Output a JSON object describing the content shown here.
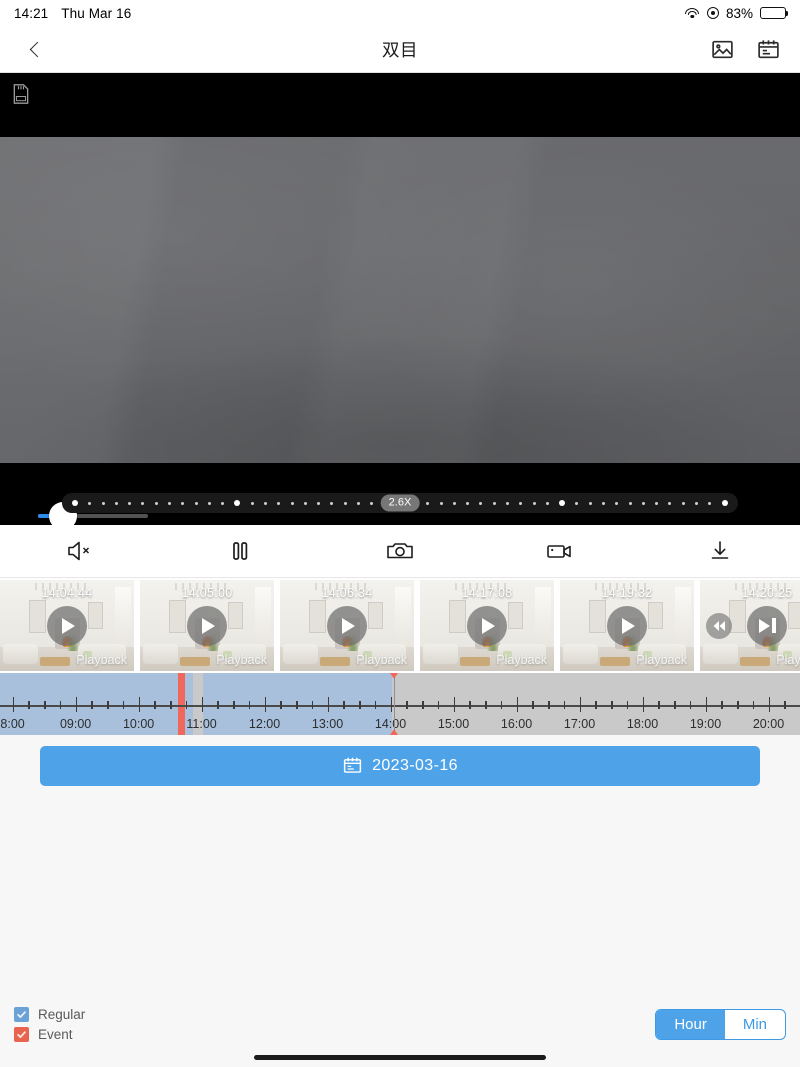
{
  "status_bar": {
    "time": "14:21",
    "date": "Thu Mar 16",
    "battery_percent": "83%",
    "wifi_icon": "wifi-icon",
    "location_icon": "location-icon",
    "battery_icon": "battery-icon"
  },
  "nav": {
    "back_icon": "back-chevron-icon",
    "title": "双目",
    "gallery_icon": "image-gallery-icon",
    "calendar_icon": "calendar-icon"
  },
  "stage": {
    "sd_card_icon": "sd-card-icon",
    "zoom_slider": {
      "value": 23,
      "accent": "#2d8cf0"
    },
    "speed": {
      "label": "2.6X",
      "dot_count": 49,
      "major_dots": [
        0,
        12,
        24,
        36,
        48
      ]
    }
  },
  "toolbar": [
    {
      "name": "mute-button",
      "icon": "speaker-mute-icon"
    },
    {
      "name": "pause-button",
      "icon": "pause-icon"
    },
    {
      "name": "snapshot-button",
      "icon": "camera-icon"
    },
    {
      "name": "record-button",
      "icon": "video-camera-icon"
    },
    {
      "name": "download-button",
      "icon": "download-icon"
    }
  ],
  "thumbnails": [
    {
      "time": "14:04:44",
      "watermark": "Playback",
      "state": "play"
    },
    {
      "time": "14:05:00",
      "watermark": "Playback",
      "state": "play"
    },
    {
      "time": "14:06:34",
      "watermark": "Playback",
      "state": "play"
    },
    {
      "time": "14:17:08",
      "watermark": "Playback",
      "state": "play"
    },
    {
      "time": "14:19:32",
      "watermark": "Playback",
      "state": "play"
    },
    {
      "time": "14:20:25",
      "watermark": "Playback",
      "state": "paused",
      "prev_icon": "rewind-icon",
      "next_icon": "fast-forward-icon"
    }
  ],
  "timeline": {
    "start_hour": 7.8,
    "end_hour": 20.5,
    "labels": [
      "8:00",
      "09:00",
      "10:00",
      "11:00",
      "12:00",
      "13:00",
      "14:00",
      "15:00",
      "16:00",
      "17:00",
      "18:00",
      "19:00",
      "20:00"
    ],
    "label_hours": [
      8,
      9,
      10,
      11,
      12,
      13,
      14,
      15,
      16,
      17,
      18,
      19,
      20
    ],
    "playhead_hour": 14.05,
    "regular_segments": [
      {
        "from": 7.8,
        "to": 10.87
      },
      {
        "from": 11.03,
        "to": 14.03
      }
    ],
    "event_segments": [
      {
        "from": 10.63,
        "to": 10.74
      }
    ],
    "colors": {
      "regular": "#a8c0dc",
      "event": "#f0675c",
      "empty": "#c9c9c9"
    }
  },
  "date_bar": {
    "icon": "calendar-icon",
    "label": "2023-03-16",
    "color": "#4ea3e8"
  },
  "footer": {
    "legend": [
      {
        "label": "Regular",
        "checked": true,
        "color": "#6ba3d6"
      },
      {
        "label": "Event",
        "checked": true,
        "color": "#e8644f"
      }
    ],
    "scale_options": [
      {
        "label": "Hour",
        "selected": true
      },
      {
        "label": "Min",
        "selected": false
      }
    ]
  }
}
